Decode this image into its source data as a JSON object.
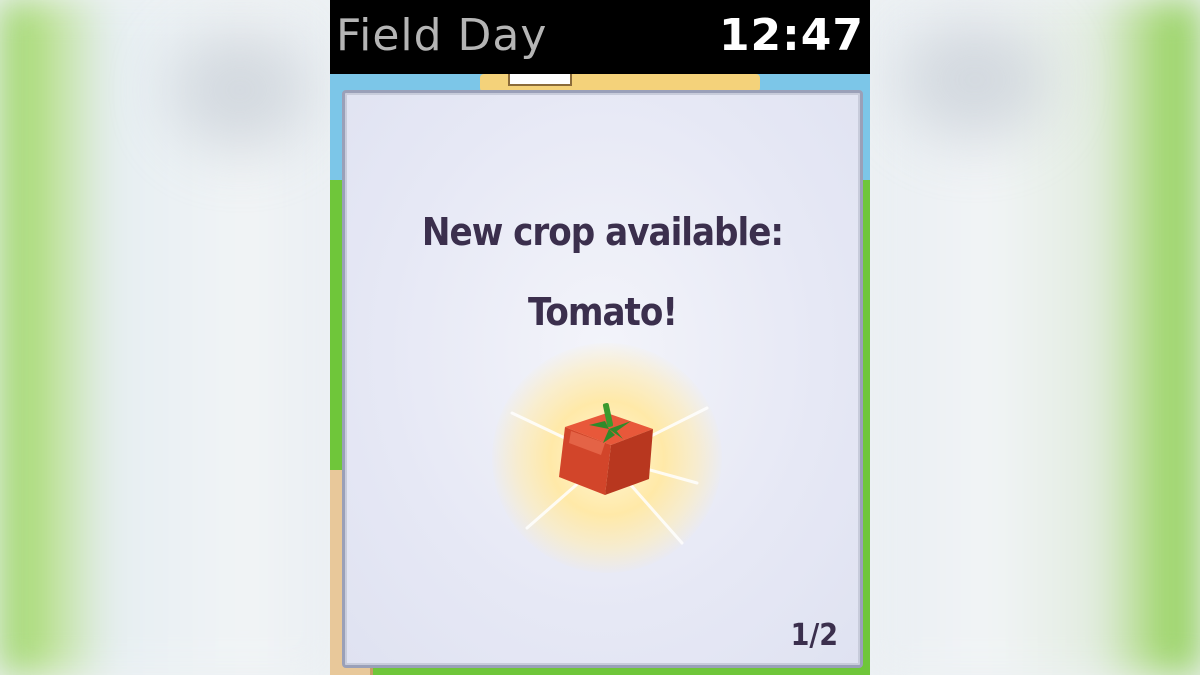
{
  "status_bar": {
    "app_name": "Field Day",
    "time": "12:47"
  },
  "card": {
    "line1": "New crop available:",
    "line2": "Tomato!",
    "crop_icon": "tomato-icon",
    "page_indicator": "1/2"
  },
  "colors": {
    "card_text": "#3b2f4d",
    "tomato": "#d94a2a",
    "grass": "#6fc63a",
    "glow": "#ffe9a8"
  }
}
